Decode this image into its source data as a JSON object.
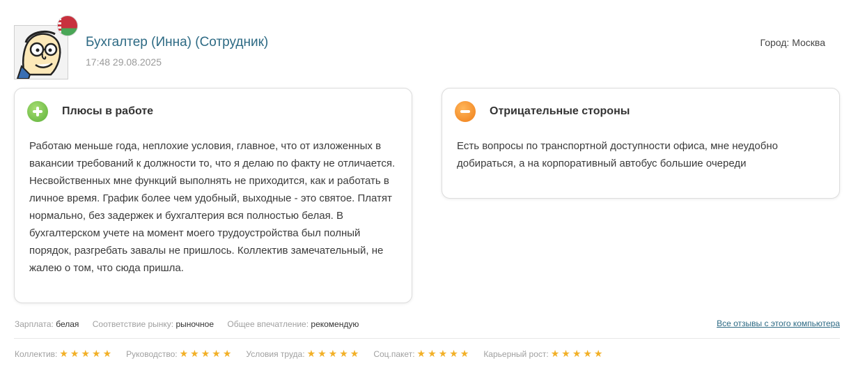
{
  "review": {
    "author": "Бухгалтер (Инна) (Сотрудник)",
    "datetime": "17:48 29.08.2025",
    "city": "Город: Москва"
  },
  "pros": {
    "title": "Плюсы в работе",
    "text": "Работаю меньше года, неплохие условия, главное, что от изложенных в вакансии требований к должности то, что я делаю по факту не отличается. Несвойственных мне функций выполнять не приходится, как и работать в личное время. График более чем удобный, выходные - это святое. Платят нормально, без задержек и бухгалтерия вся полностью белая. В бухгалтерском учете на момент моего трудоустройства был полный порядок, разгребать завалы не пришлось. Коллектив замечательный, не жалею о том, что сюда пришла."
  },
  "cons": {
    "title": "Отрицательные стороны",
    "text": "Есть вопросы по транспортной доступности офиса, мне неудобно добираться, а на корпоративный автобус большие очереди"
  },
  "meta": {
    "salary_label": "Зарплата:",
    "salary_value": "белая",
    "market_label": "Соответствие рынку:",
    "market_value": "рыночное",
    "impression_label": "Общее впечатление:",
    "impression_value": "рекомендую",
    "all_reviews_link": "Все отзывы с этого компьютера"
  },
  "ratings": [
    {
      "label": "Коллектив:",
      "stars": "★★★★★",
      "score": 5
    },
    {
      "label": "Руководство:",
      "stars": "★★★★★",
      "score": 5
    },
    {
      "label": "Условия труда:",
      "stars": "★★★★★",
      "score": 5
    },
    {
      "label": "Соц.пакет:",
      "stars": "★★★★★",
      "score": 5
    },
    {
      "label": "Карьерный рост:",
      "stars": "★★★★★",
      "score": 5
    }
  ],
  "colors": {
    "accent": "#2d6a84",
    "star": "#f2b027",
    "plus": "#5db13a",
    "minus": "#ef7d17"
  },
  "icons": {
    "avatar": "cartoon-face-avatar",
    "flag": "belarus-flag-icon",
    "pros": "plus-circle-icon",
    "cons": "minus-circle-icon",
    "star": "star-icon"
  }
}
